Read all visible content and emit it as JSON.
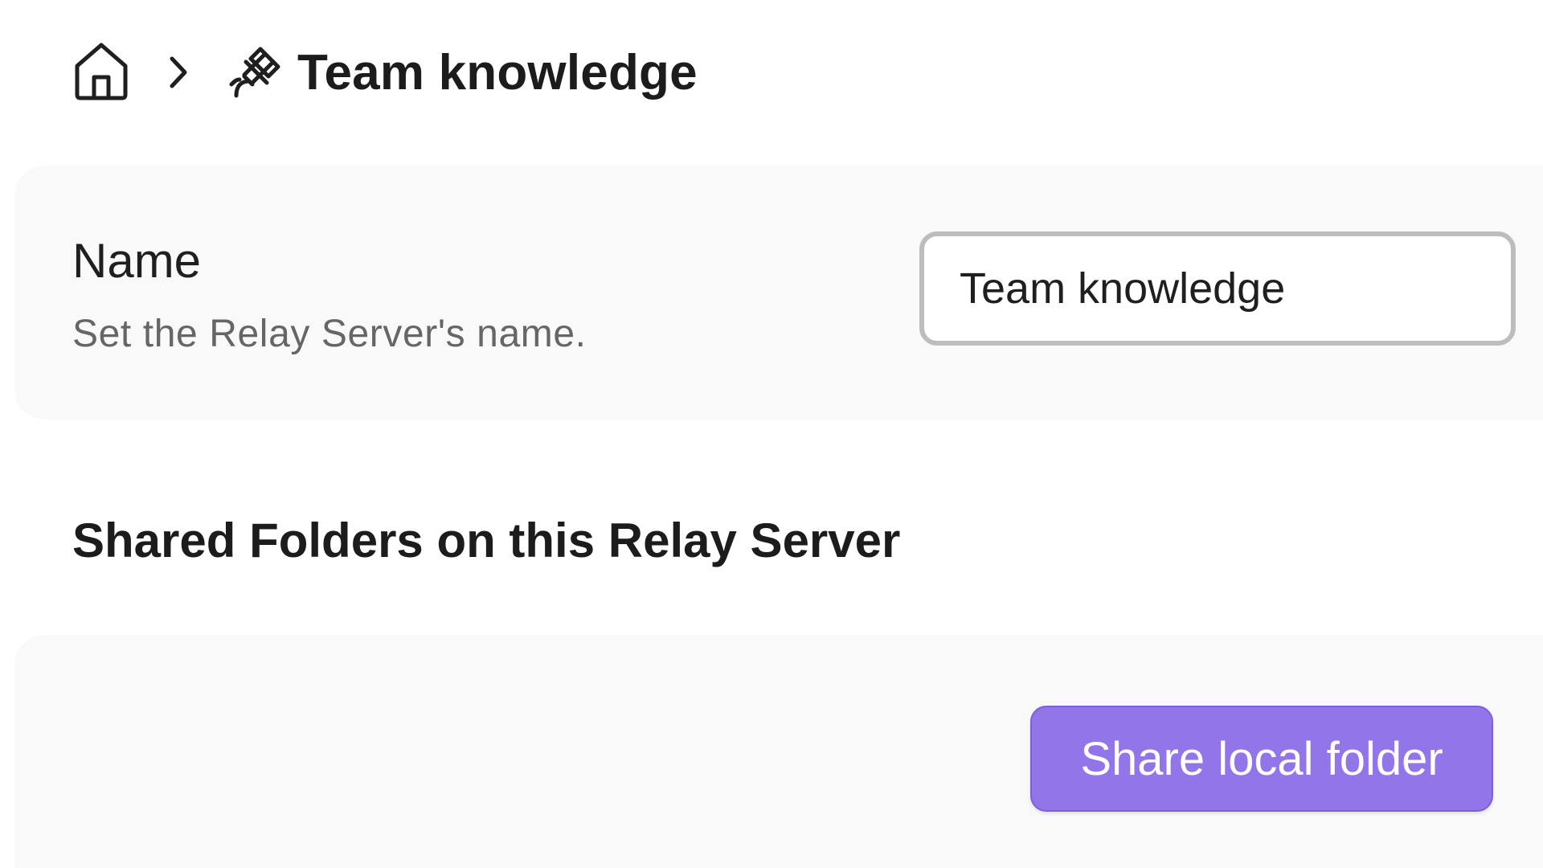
{
  "breadcrumb": {
    "home_icon": "home-icon",
    "separator_icon": "chevron-right-icon",
    "current_icon": "satellite-icon",
    "current_title": "Team knowledge"
  },
  "name_setting": {
    "label": "Name",
    "description": "Set the Relay Server's name.",
    "value": "Team knowledge"
  },
  "shared_folders": {
    "heading": "Shared Folders on this Relay Server",
    "share_button_label": "Share local folder"
  },
  "colors": {
    "accent": "#9375ea",
    "card_background": "#f9f9f9",
    "input_border": "#bdbdbd"
  }
}
